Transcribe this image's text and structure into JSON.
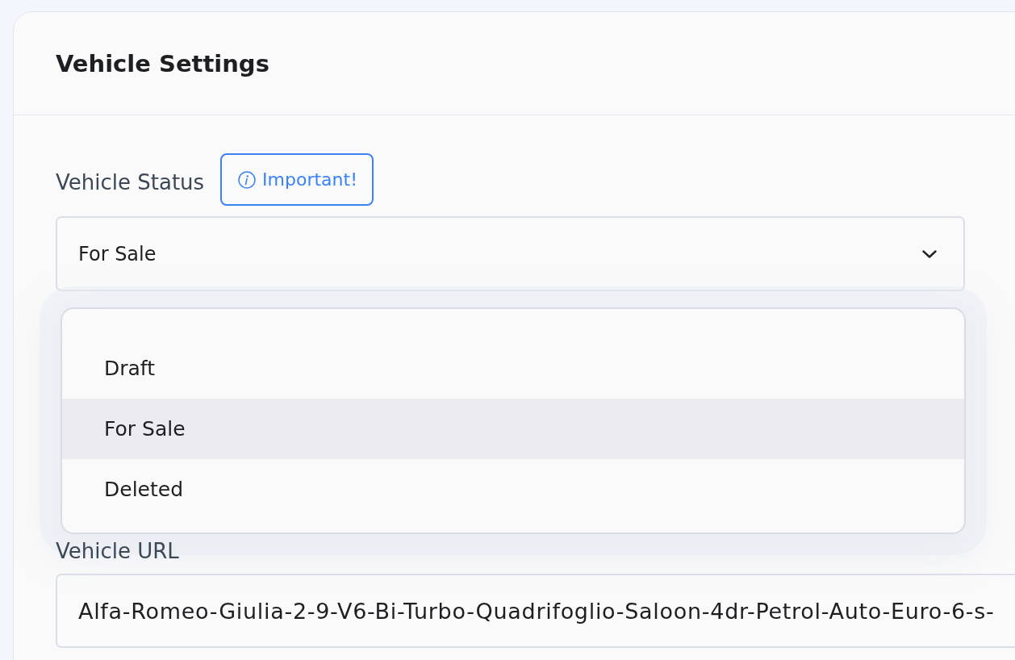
{
  "card": {
    "title": "Vehicle Settings"
  },
  "status_field": {
    "label": "Vehicle Status",
    "badge": "Important!",
    "value": "For Sale",
    "expanded": true,
    "options": [
      {
        "label": "Draft",
        "selected": false
      },
      {
        "label": "For Sale",
        "selected": true
      },
      {
        "label": "Deleted",
        "selected": false
      }
    ]
  },
  "url_field": {
    "label": "Vehicle URL",
    "value": "Alfa-Romeo-Giulia-2-9-V6-Bi-Turbo-Quadrifoglio-Saloon-4dr-Petrol-Auto-Euro-6-s-"
  }
}
